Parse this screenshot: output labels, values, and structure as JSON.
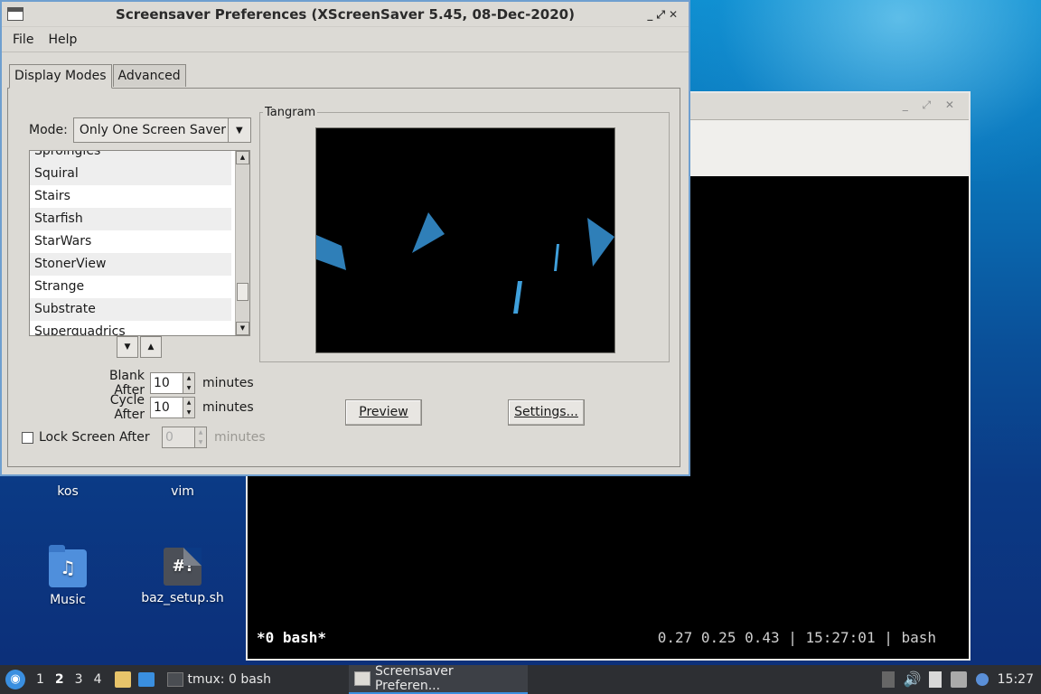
{
  "dialog": {
    "title": "Screensaver Preferences  (XScreenSaver 5.45, 08-Dec-2020)",
    "menu": {
      "file": "File",
      "help": "Help"
    },
    "tabs": [
      "Display Modes",
      "Advanced"
    ],
    "mode_label": "Mode:",
    "mode_value": "Only One Screen Saver",
    "list_items": [
      "Sproingies",
      "Squiral",
      "Stairs",
      "Starfish",
      "StarWars",
      "StonerView",
      "Strange",
      "Substrate",
      "Superquadrics"
    ],
    "blank_after": {
      "label": "Blank After",
      "value": "10",
      "unit": "minutes"
    },
    "cycle_after": {
      "label": "Cycle After",
      "value": "10",
      "unit": "minutes"
    },
    "lock_after": {
      "label": "Lock Screen After",
      "value": "0",
      "unit": "minutes",
      "checked": false
    },
    "preview_title": "Tangram",
    "preview_button": "Preview",
    "settings_button": "Settings..."
  },
  "desktop": {
    "icons": [
      {
        "label": "kos"
      },
      {
        "label": "vim"
      },
      {
        "label": "Music",
        "glyph": "♫"
      },
      {
        "label": "baz_setup.sh",
        "glyph": "#!"
      }
    ]
  },
  "terminal": {
    "status_left": "*0 bash*",
    "status_right": "0.27 0.25 0.43 | 15:27:01 | bash"
  },
  "taskbar": {
    "workspaces": [
      "1",
      "2",
      "3",
      "4"
    ],
    "current_workspace": "2",
    "apps": [
      {
        "label": "tmux: 0 bash"
      },
      {
        "label": "Screensaver Preferen..."
      }
    ],
    "clock": "15:27"
  },
  "colors": {
    "accent": "#3a8fe0",
    "shape": "#2f7fb8"
  }
}
